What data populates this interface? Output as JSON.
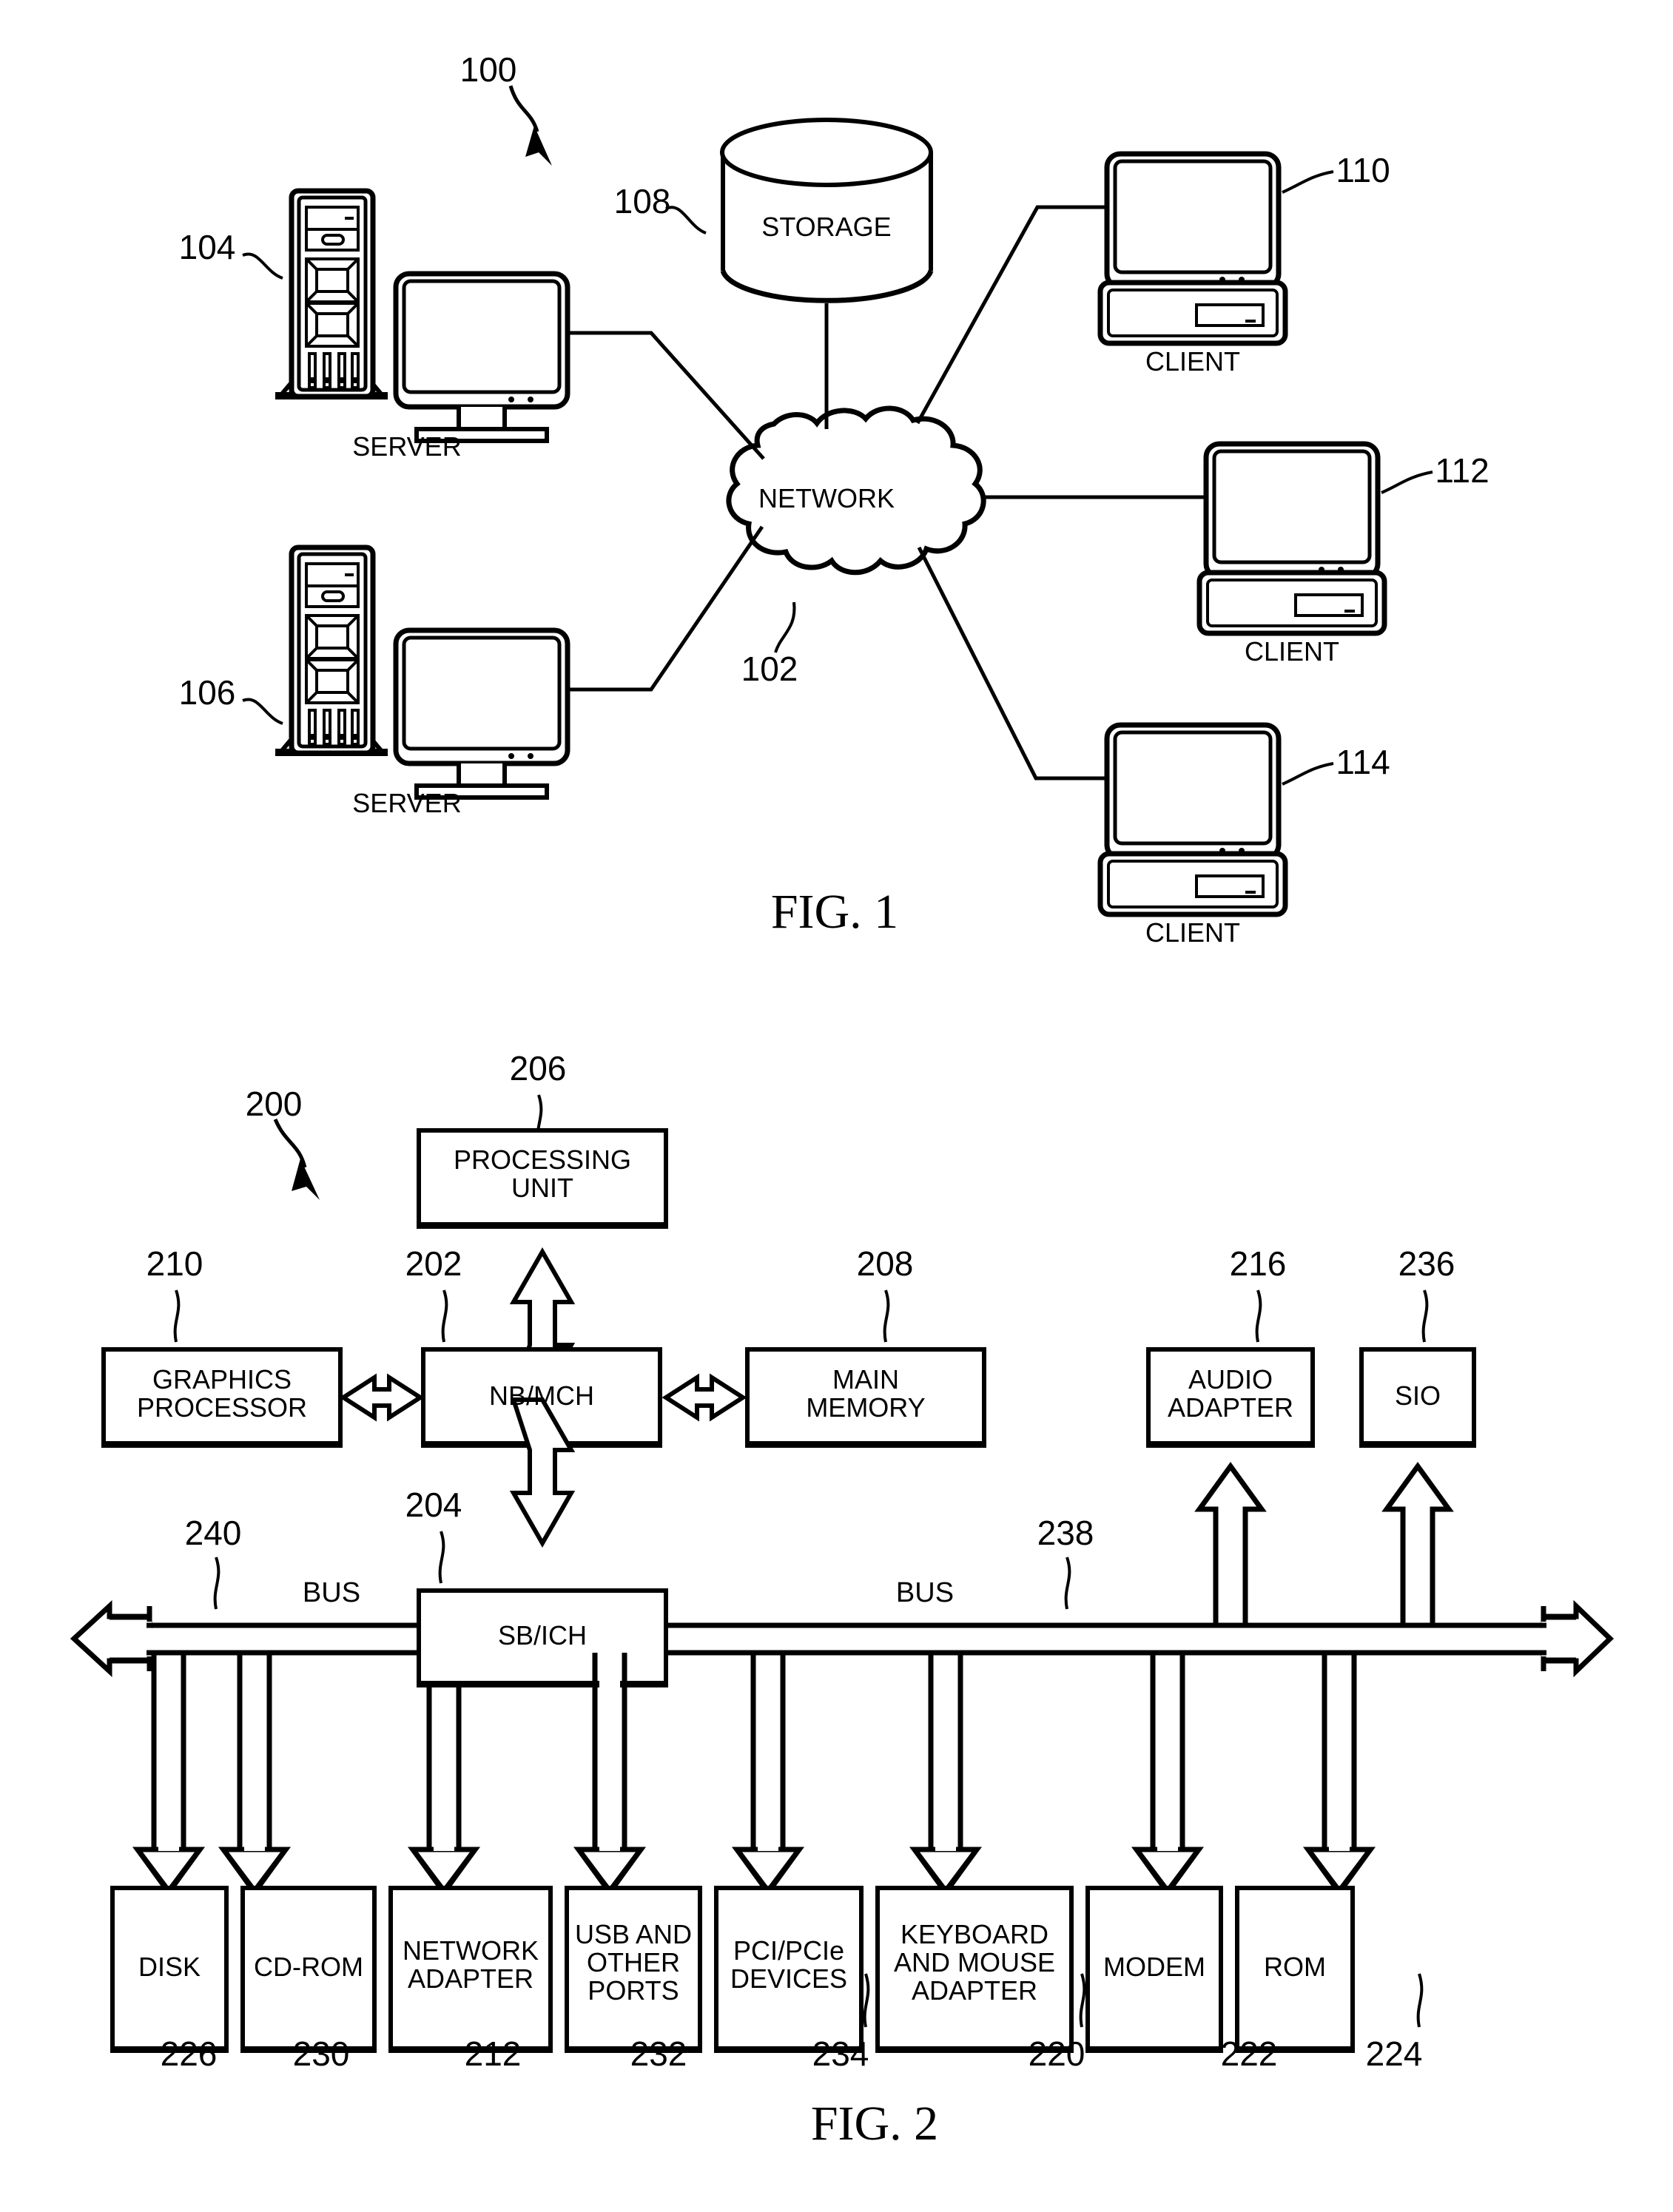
{
  "figures": [
    {
      "id": "fig1",
      "caption": "FIG. 1",
      "ref_main": "100",
      "nodes": {
        "network": {
          "label": "NETWORK",
          "ref": "102"
        },
        "storage": {
          "label": "STORAGE",
          "ref": "108"
        },
        "server_top": {
          "label": "SERVER",
          "ref": "104"
        },
        "server_bottom": {
          "label": "SERVER",
          "ref": "106"
        },
        "client_top": {
          "label": "CLIENT",
          "ref": "110"
        },
        "client_middle": {
          "label": "CLIENT",
          "ref": "112"
        },
        "client_bottom": {
          "label": "CLIENT",
          "ref": "114"
        }
      }
    },
    {
      "id": "fig2",
      "caption": "FIG. 2",
      "ref_main": "200",
      "bus_label_left": "BUS",
      "bus_label_right": "BUS",
      "bus_ref_left": "240",
      "bus_ref_right": "238",
      "blocks": [
        {
          "name": "processing-unit",
          "label": "PROCESSING\nUNIT",
          "ref": "206"
        },
        {
          "name": "graphics-processor",
          "label": "GRAPHICS\nPROCESSOR",
          "ref": "210"
        },
        {
          "name": "nb-mch",
          "label": "NB/MCH",
          "ref": "202"
        },
        {
          "name": "main-memory",
          "label": "MAIN\nMEMORY",
          "ref": "208"
        },
        {
          "name": "audio-adapter",
          "label": "AUDIO\nADAPTER",
          "ref": "216"
        },
        {
          "name": "sio",
          "label": "SIO",
          "ref": "236"
        },
        {
          "name": "sb-ich",
          "label": "SB/ICH",
          "ref": "204"
        },
        {
          "name": "disk",
          "label": "DISK",
          "ref": "226"
        },
        {
          "name": "cd-rom",
          "label": "CD-ROM",
          "ref": "230"
        },
        {
          "name": "network-adapter",
          "label": "NETWORK\nADAPTER",
          "ref": "212"
        },
        {
          "name": "usb-other-ports",
          "label": "USB AND\nOTHER\nPORTS",
          "ref": "232"
        },
        {
          "name": "pci-pcie-devices",
          "label": "PCI/PCIe\nDEVICES",
          "ref": "234"
        },
        {
          "name": "keyboard-mouse-adapter",
          "label": "KEYBOARD\nAND MOUSE\nADAPTER",
          "ref": "220"
        },
        {
          "name": "modem",
          "label": "MODEM",
          "ref": "222"
        },
        {
          "name": "rom",
          "label": "ROM",
          "ref": "224"
        }
      ]
    }
  ],
  "colors": {
    "ink": "#000000",
    "paper": "#ffffff"
  }
}
